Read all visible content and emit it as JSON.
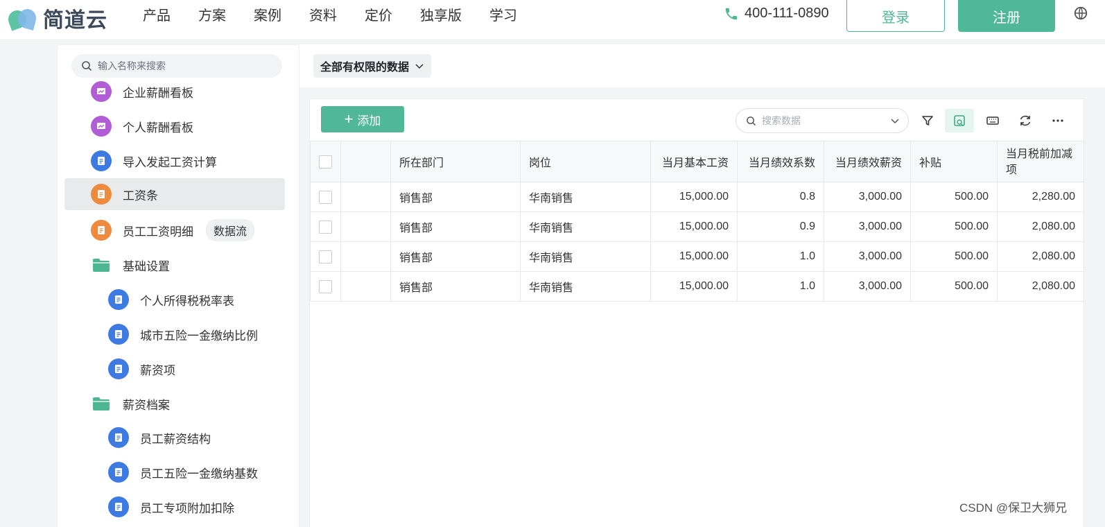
{
  "brand": {
    "name": "简道云"
  },
  "nav": {
    "items": [
      "产品",
      "方案",
      "案例",
      "资料",
      "定价",
      "独享版",
      "学习"
    ]
  },
  "header": {
    "phone": "400-111-0890",
    "login_label": "登录",
    "register_label": "注册"
  },
  "sidebar": {
    "search_placeholder": "输入名称来搜索",
    "items": [
      {
        "label": "企业薪酬看板",
        "icon": "dashboard-icon"
      },
      {
        "label": "个人薪酬看板",
        "icon": "dashboard-icon"
      },
      {
        "label": "导入发起工资计算",
        "icon": "form-icon"
      },
      {
        "label": "工资条",
        "icon": "form-icon",
        "active": true
      },
      {
        "label": "员工工资明细",
        "icon": "form-icon",
        "tag": "数据流"
      },
      {
        "label": "基础设置",
        "icon": "folder-icon"
      },
      {
        "label": "个人所得税税率表",
        "icon": "form-icon"
      },
      {
        "label": "城市五险一金缴纳比例",
        "icon": "form-icon"
      },
      {
        "label": "薪资项",
        "icon": "form-icon"
      },
      {
        "label": "薪资档案",
        "icon": "folder-icon"
      },
      {
        "label": "员工薪资结构",
        "icon": "form-icon"
      },
      {
        "label": "员工五险一金缴纳基数",
        "icon": "form-icon"
      },
      {
        "label": "员工专项附加扣除",
        "icon": "form-icon"
      }
    ]
  },
  "main": {
    "filter_label": "全部有权限的数据",
    "add_label": "添加",
    "search_placeholder": "搜索数据",
    "table": {
      "columns": [
        "所在部门",
        "岗位",
        "当月基本工资",
        "当月绩效系数",
        "当月绩效薪资",
        "补贴",
        "当月税前加减项"
      ],
      "rows": [
        [
          "销售部",
          "华南销售",
          "15,000.00",
          "0.8",
          "3,000.00",
          "500.00",
          "2,280.00"
        ],
        [
          "销售部",
          "华南销售",
          "15,000.00",
          "0.9",
          "3,000.00",
          "500.00",
          "2,080.00"
        ],
        [
          "销售部",
          "华南销售",
          "15,000.00",
          "1.0",
          "3,000.00",
          "500.00",
          "2,080.00"
        ],
        [
          "销售部",
          "华南销售",
          "15,000.00",
          "1.0",
          "3,000.00",
          "500.00",
          "2,080.00"
        ]
      ]
    }
  },
  "colors": {
    "accent": "#50b896",
    "blue_icon": "#3d7ae2",
    "orange_icon": "#ee8a3d",
    "purple_icon": "#b15dd6",
    "folder": "#4fb694"
  },
  "watermark": "CSDN @保卫大狮兄"
}
